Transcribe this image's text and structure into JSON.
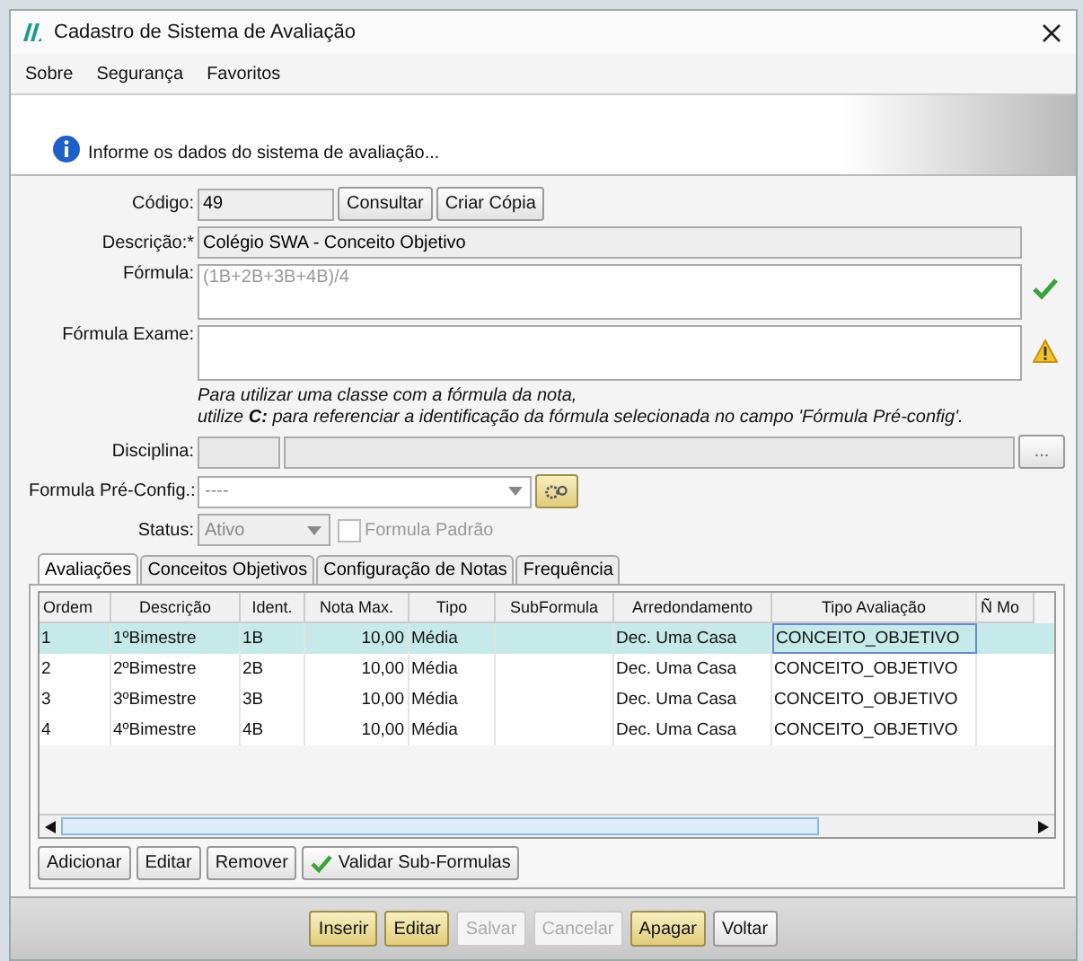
{
  "window": {
    "title": "Cadastro de Sistema de Avaliação"
  },
  "menu": [
    "Sobre",
    "Segurança",
    "Favoritos"
  ],
  "info": {
    "message": "Informe os dados do sistema de avaliação..."
  },
  "form": {
    "codigo": {
      "label": "Código:",
      "value": "49"
    },
    "codigo_buttons": [
      "Consultar",
      "Criar Cópia"
    ],
    "descricao": {
      "label": "Descrição:*",
      "value": "Colégio SWA - Conceito Objetivo"
    },
    "formula": {
      "label": "Fórmula:",
      "value": "(1B+2B+3B+4B)/4",
      "valid": true
    },
    "formula_exame": {
      "label": "Fórmula Exame:",
      "warning": true
    },
    "note": [
      "Para utilizar uma classe com a fórmula da nota,",
      "utilize **C:** para referenciar a identificação da fórmula selecionada no campo 'Fórmula Pré-config'."
    ],
    "disciplina": {
      "label": "Disciplina:",
      "button": "..."
    },
    "formula_preconfig": {
      "label": "Formula Pré-Config.:",
      "value": "----"
    },
    "status": {
      "label": "Status:",
      "value": "Ativo",
      "disabled": true
    },
    "formula_padrao": {
      "label": "Formula Padrão",
      "checked": false,
      "disabled": true
    }
  },
  "tabs": [
    {
      "label": "Avaliações",
      "selected": true
    },
    {
      "label": "Conceitos Objetivos",
      "selected": false
    },
    {
      "label": "Configuração de Notas",
      "selected": false
    },
    {
      "label": "Frequência",
      "selected": false
    }
  ],
  "table": {
    "columns": [
      "Ordem",
      "Descrição",
      "Ident.",
      "Nota Max.",
      "Tipo",
      "SubFormula",
      "Arredondamento",
      "Tipo Avaliação",
      "Ñ Mo"
    ],
    "rows": [
      {
        "cells": [
          "1",
          "1ºBimestre",
          "1B",
          "10,00",
          "Média",
          "",
          "Dec. Uma Casa",
          "CONCEITO_OBJETIVO"
        ],
        "selected": true
      },
      {
        "cells": [
          "2",
          "2ºBimestre",
          "2B",
          "10,00",
          "Média",
          "",
          "Dec. Uma Casa",
          "CONCEITO_OBJETIVO"
        ],
        "selected": false
      },
      {
        "cells": [
          "3",
          "3ºBimestre",
          "3B",
          "10,00",
          "Média",
          "",
          "Dec. Uma Casa",
          "CONCEITO_OBJETIVO"
        ],
        "selected": false
      },
      {
        "cells": [
          "4",
          "4ºBimestre",
          "4B",
          "10,00",
          "Média",
          "",
          "Dec. Uma Casa",
          "CONCEITO_OBJETIVO"
        ],
        "selected": false
      }
    ]
  },
  "table_buttons": [
    {
      "label": "Adicionar",
      "kind": "plain"
    },
    {
      "label": "Editar",
      "kind": "plain"
    },
    {
      "label": "Remover",
      "kind": "plain"
    },
    {
      "label": "Validar Sub-Formulas",
      "kind": "check"
    }
  ],
  "footer_buttons": [
    {
      "label": "Inserir",
      "highlighted": true,
      "disabled": false
    },
    {
      "label": "Editar",
      "highlighted": true,
      "disabled": false
    },
    {
      "label": "Salvar",
      "highlighted": false,
      "disabled": true
    },
    {
      "label": "Cancelar",
      "highlighted": false,
      "disabled": true
    },
    {
      "label": "Apagar",
      "highlighted": true,
      "disabled": false
    },
    {
      "label": "Voltar",
      "highlighted": false,
      "disabled": false
    }
  ]
}
